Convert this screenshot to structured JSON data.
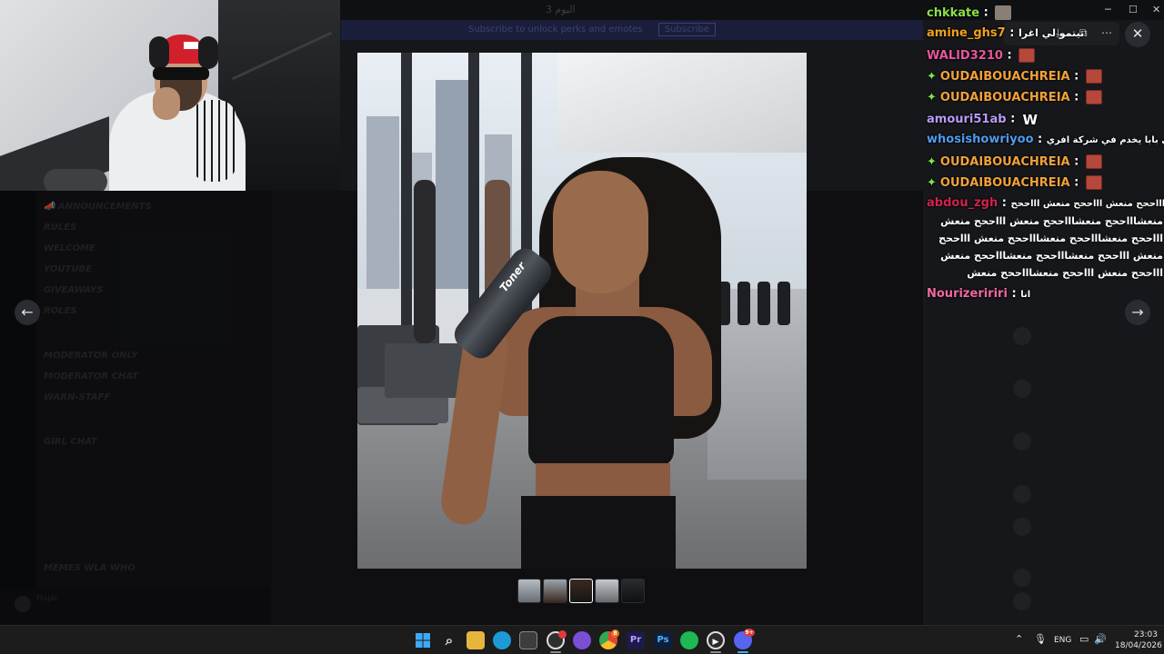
{
  "discord": {
    "window_title": "اليوم 3",
    "banner": "Subscribe to unlock perks and emotes",
    "banner_button": "Subscribe",
    "channels": [
      "📣 ANNOUNCEMENTS",
      "RULES",
      "WELCOME",
      "YOUTUBE",
      "GIVEAWAYS",
      "ROLES",
      "MODERATOR ONLY",
      "MODERATOR CHAT",
      "WARN-STAFF",
      "GIRL CHAT",
      "MEMES WLA WHO"
    ],
    "user_panel_name": "Hajar"
  },
  "viewer": {
    "bottle_brand": "Toner",
    "thumbnails": [
      "image 1",
      "image 2",
      "image 3",
      "image 4",
      "image 5"
    ],
    "prev_label": "←",
    "next_label": "→",
    "close_label": "✕",
    "toolbar": {
      "download": "⤓",
      "open": "⧉",
      "more": "⋯"
    }
  },
  "chat": {
    "messages": [
      {
        "user": "chkkate",
        "color": "#8be04a",
        "sep": " :",
        "text": "",
        "emote": "face",
        "badge": false
      },
      {
        "user": "amine_ghs7",
        "color": "#f0a11f",
        "sep": " :",
        "text": "نيتمو لي اغرا",
        "emote": "",
        "badge": false
      },
      {
        "user": "WALID3210",
        "color": "#e8569a",
        "sep": " :",
        "text": "",
        "emote": "red",
        "badge": false
      },
      {
        "user": "OUDAIBOUACHREIA",
        "color": "#f2a13a",
        "sep": " :",
        "text": "",
        "emote": "red",
        "badge": true
      },
      {
        "user": "OUDAIBOUACHREIA",
        "color": "#f2a13a",
        "sep": " :",
        "text": "",
        "emote": "red",
        "badge": true
      },
      {
        "user": "amouri51ab",
        "color": "#b69cf7",
        "sep": " :",
        "text": "",
        "emote": "w",
        "badge": false
      },
      {
        "user": "whosishowriyoo",
        "color": "#4f9cf0",
        "sep": " :",
        "text": "انا عندي بابا يخدم في شركة افري",
        "emote": "",
        "badge": false
      },
      {
        "user": "OUDAIBOUACHREIA",
        "color": "#f2a13a",
        "sep": " :",
        "text": "",
        "emote": "red",
        "badge": true
      },
      {
        "user": "OUDAIBOUACHREIA",
        "color": "#f2a13a",
        "sep": " :",
        "text": "",
        "emote": "red",
        "badge": true
      },
      {
        "user": "abdou_zgh",
        "color": "#d1224f",
        "sep": " :",
        "text": "اااححح منعش اااححح منعش اااححح",
        "emote": "",
        "badge": false
      },
      {
        "user": "Nourizeririri",
        "color": "#f06aa0",
        "sep": " :",
        "text": "انا",
        "emote": "",
        "badge": false
      }
    ],
    "abdou_continuation": [
      "منعشاااححح منعشاااححح منعش اااححح منعش",
      "اااححح منعشاااححح منعشاااححح منعش اااححح",
      "منعش اااححح منعشاااححح منعشاااححح منعش",
      "اااححح منعش اااححح منعشاااححح منعش"
    ]
  },
  "taskbar": {
    "language": "ENG",
    "time": "23:03",
    "date": "18/04/2026",
    "apps": [
      "windows-start",
      "search",
      "file-explorer",
      "edge",
      "store",
      "obs",
      "chat-app",
      "chrome",
      "premiere",
      "photoshop",
      "spotify-like",
      "media-player",
      "discord"
    ],
    "badges": {
      "obs": "",
      "chrome": "8",
      "discord": "9+"
    }
  },
  "colors": {
    "discord_bg": "#16171a",
    "taskbar_bg": "#1c1c1c",
    "badge_green": "#7ee34e"
  }
}
